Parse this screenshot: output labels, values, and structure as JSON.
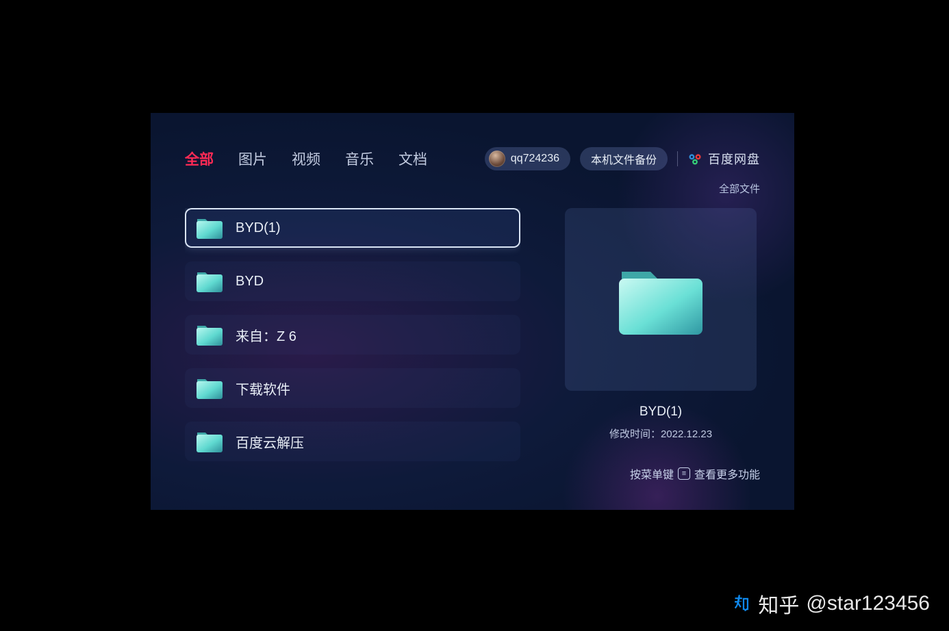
{
  "tabs": [
    {
      "label": "全部",
      "active": true
    },
    {
      "label": "图片",
      "active": false
    },
    {
      "label": "视频",
      "active": false
    },
    {
      "label": "音乐",
      "active": false
    },
    {
      "label": "文档",
      "active": false
    }
  ],
  "header": {
    "username": "qq724236",
    "backup_button": "本机文件备份",
    "brand": "百度网盘"
  },
  "breadcrumb": "全部文件",
  "files": [
    {
      "name": "BYD(1)",
      "selected": true
    },
    {
      "name": "BYD",
      "selected": false
    },
    {
      "name": "来自：Z 6",
      "selected": false
    },
    {
      "name": "下载软件",
      "selected": false
    },
    {
      "name": "百度云解压",
      "selected": false
    }
  ],
  "preview": {
    "name": "BYD(1)",
    "meta_label": "修改时间：",
    "meta_value": "2022.12.23",
    "hint_prefix": "按菜单键",
    "hint_suffix": "查看更多功能"
  },
  "watermark": {
    "site": "知乎",
    "handle": "@star123456"
  }
}
